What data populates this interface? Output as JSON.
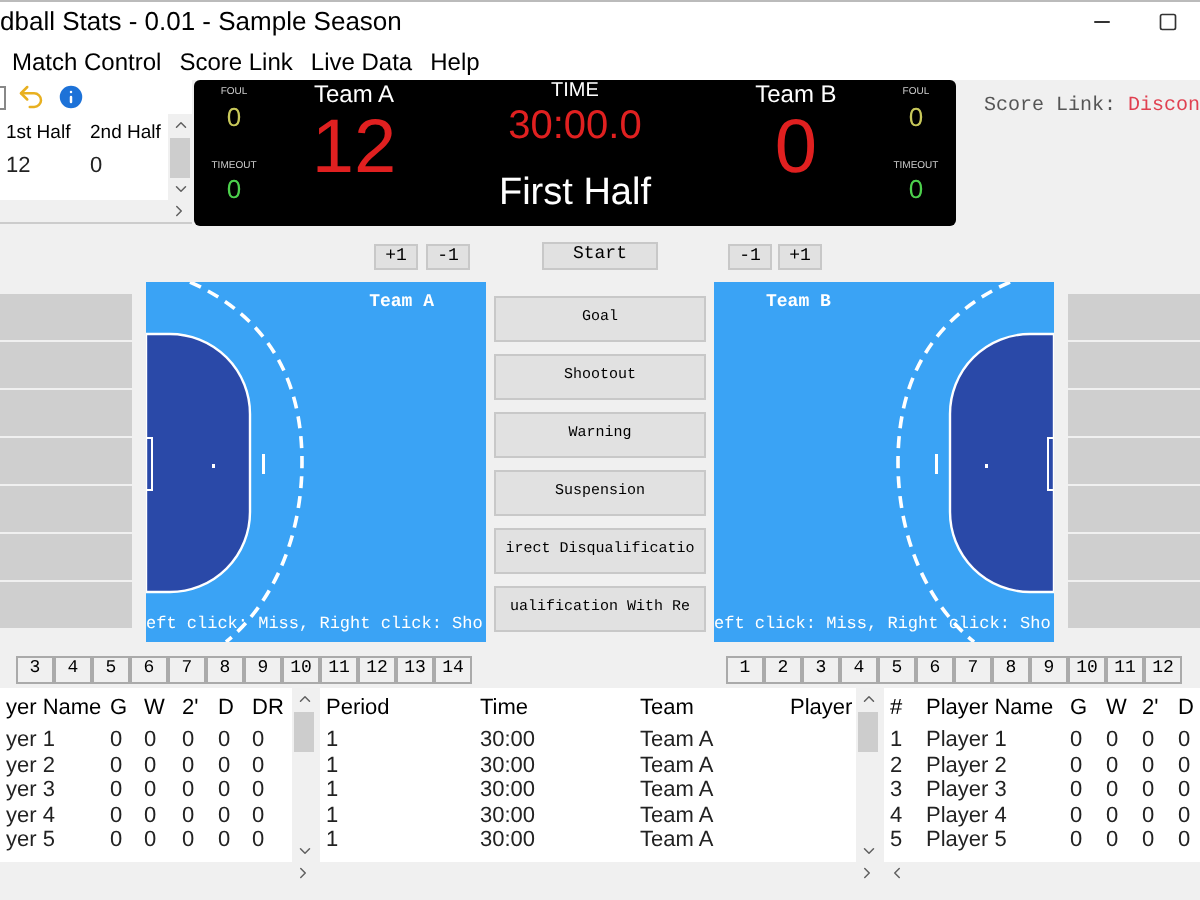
{
  "window": {
    "title": "dball Stats - 0.01 - Sample Season"
  },
  "menu": [
    "Match Control",
    "Score Link",
    "Live Data",
    "Help"
  ],
  "half_table": {
    "columns": [
      "1st Half",
      "2nd Half"
    ],
    "rows": [
      [
        "12",
        "0"
      ]
    ]
  },
  "scoreboard": {
    "home": {
      "name": "Team A",
      "score": "12",
      "foul_label": "FOUL",
      "foul": "0",
      "timeout_label": "TIMEOUT",
      "timeout": "0"
    },
    "time_label": "TIME",
    "time": "30:00.0",
    "period": "First Half",
    "away": {
      "name": "Team B",
      "score": "0",
      "foul_label": "FOUL",
      "foul": "0",
      "timeout_label": "TIMEOUT",
      "timeout": "0"
    }
  },
  "score_link": {
    "label": "Score Link:",
    "status": "Discon"
  },
  "controls": {
    "home": [
      "+1",
      "-1"
    ],
    "start": "Start",
    "away": [
      "-1",
      "+1"
    ]
  },
  "courts": [
    {
      "mirrored": false,
      "team": "Team A",
      "hint": "eft click: Miss, Right click: Sho"
    },
    {
      "mirrored": true,
      "team": "Team B",
      "hint": "eft click: Miss, Right click: Sho"
    }
  ],
  "actions": [
    "Goal",
    "Shootout",
    "Warning",
    "Suspension",
    "irect Disqualificatio",
    "ualification With Re"
  ],
  "left_player_tabs": [
    "3",
    "4",
    "5",
    "6",
    "7",
    "8",
    "9",
    "10",
    "11",
    "12",
    "13",
    "14"
  ],
  "right_player_tabs": [
    "1",
    "2",
    "3",
    "4",
    "5",
    "6",
    "7",
    "8",
    "9",
    "10",
    "11",
    "12"
  ],
  "left_players": {
    "columns": [
      "yer Name",
      "G",
      "W",
      "2'",
      "D",
      "DR"
    ],
    "rows": [
      [
        "yer 1",
        "0",
        "0",
        "0",
        "0",
        "0"
      ],
      [
        "yer 2",
        "0",
        "0",
        "0",
        "0",
        "0"
      ],
      [
        "yer 3",
        "0",
        "0",
        "0",
        "0",
        "0"
      ],
      [
        "yer 4",
        "0",
        "0",
        "0",
        "0",
        "0"
      ],
      [
        "yer 5",
        "0",
        "0",
        "0",
        "0",
        "0"
      ]
    ]
  },
  "events": {
    "columns": [
      "Period",
      "Time",
      "Team",
      "Player"
    ],
    "rows": [
      [
        "1",
        "30:00",
        "Team A",
        ""
      ],
      [
        "1",
        "30:00",
        "Team A",
        ""
      ],
      [
        "1",
        "30:00",
        "Team A",
        ""
      ],
      [
        "1",
        "30:00",
        "Team A",
        ""
      ],
      [
        "1",
        "30:00",
        "Team A",
        ""
      ]
    ]
  },
  "right_players": {
    "columns": [
      "#",
      "Player Name",
      "G",
      "W",
      "2'",
      "D"
    ],
    "rows": [
      [
        "1",
        "Player 1",
        "0",
        "0",
        "0",
        "0"
      ],
      [
        "2",
        "Player 2",
        "0",
        "0",
        "0",
        "0"
      ],
      [
        "3",
        "Player 3",
        "0",
        "0",
        "0",
        "0"
      ],
      [
        "4",
        "Player 4",
        "0",
        "0",
        "0",
        "0"
      ],
      [
        "5",
        "Player 5",
        "0",
        "0",
        "0",
        "0"
      ]
    ]
  }
}
